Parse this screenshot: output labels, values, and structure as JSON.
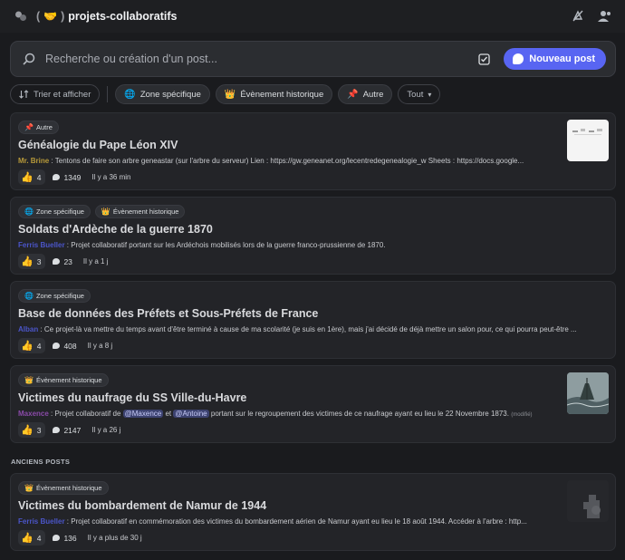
{
  "topbar": {
    "channel_icon": "forum-icon",
    "emoji": "🤝",
    "title": "projets-collaboratifs",
    "icons": [
      "notification-off-icon",
      "members-icon"
    ]
  },
  "search": {
    "placeholder": "Recherche ou création d'un post...",
    "new_post_label": "Nouveau post"
  },
  "filters": {
    "sort_label": "Trier et afficher",
    "tags": [
      {
        "emoji": "🌐",
        "label": "Zone spécifique"
      },
      {
        "emoji": "👑",
        "label": "Évènement historique"
      },
      {
        "emoji": "📌",
        "label": "Autre"
      }
    ],
    "all_label": "Tout"
  },
  "posts": [
    {
      "tags": [
        {
          "emoji": "📌",
          "label": "Autre"
        }
      ],
      "title": "Généalogie du Pape Léon XIV",
      "author": "Mr. Brine",
      "text": "Tentons de faire son arbre geneastar (sur l'arbre du serveur) Lien : https://gw.geneanet.org/lecentredegenealogie_w Sheets : https://docs.google...",
      "reactions": "4",
      "messages": "1349",
      "ago": "Il y a 36 min"
    },
    {
      "tags": [
        {
          "emoji": "🌐",
          "label": "Zone spécifique"
        },
        {
          "emoji": "👑",
          "label": "Évènement historique"
        }
      ],
      "title": "Soldats d'Ardèche de la guerre 1870",
      "author": "Ferris Bueller",
      "text": "Projet collaboratif portant sur les Ardéchois mobilisés lors de la guerre franco-prussienne de 1870.",
      "reactions": "3",
      "messages": "23",
      "ago": "Il y a 1 j"
    },
    {
      "tags": [
        {
          "emoji": "🌐",
          "label": "Zone spécifique"
        }
      ],
      "title": "Base de données des Préfets et Sous-Préfets de France",
      "author": "Alban",
      "text": "Ce projet-là va mettre du temps avant d'être terminé à cause de ma scolarité (je suis en 1ère), mais j'ai décidé de déjà mettre un salon pour, ce qui pourra peut-être ...",
      "reactions": "4",
      "messages": "408",
      "ago": "Il y a 8 j"
    },
    {
      "tags": [
        {
          "emoji": "👑",
          "label": "Évènement historique"
        }
      ],
      "title": "Victimes du naufrage du SS Ville-du-Havre",
      "author": "Maxence",
      "text_before": "Projet collaboratif de",
      "mention1": "@Maxence",
      "text_mid": "et",
      "mention2": "@Antoine",
      "text_after": "portant sur le regroupement des victimes de ce naufrage ayant eu lieu le 22 Novembre 1873.",
      "modified": "(modifié)",
      "reactions": "3",
      "messages": "2147",
      "ago": "Il y a 26 j"
    }
  ],
  "old_section_label": "ANCIENS POSTS",
  "old_posts": [
    {
      "tags": [
        {
          "emoji": "👑",
          "label": "Évènement historique"
        }
      ],
      "title": "Victimes du bombardement de Namur de 1944",
      "author": "Ferris Bueller",
      "text": "Projet collaboratif en commémoration des victimes du bombardement aérien de Namur ayant eu lieu le 18 août 1944. Accéder à l'arbre : http...",
      "reactions": "4",
      "messages": "136",
      "ago": "Il y a plus de 30 j"
    }
  ]
}
